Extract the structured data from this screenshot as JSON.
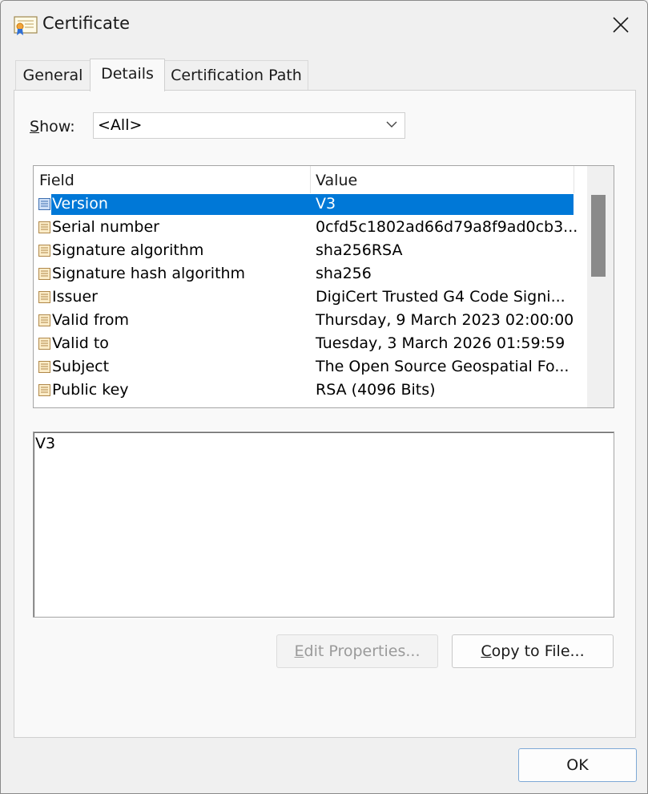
{
  "window": {
    "title": "Certificate",
    "icon": "certificate-icon",
    "close_icon": "close-icon"
  },
  "tabs": [
    {
      "label": "General",
      "active": false
    },
    {
      "label": "Details",
      "active": true
    },
    {
      "label": "Certification Path",
      "active": false
    }
  ],
  "show": {
    "label_prefix": "",
    "label_underlined": "S",
    "label_rest": "how:",
    "selected": "<All>"
  },
  "list": {
    "headers": {
      "field": "Field",
      "value": "Value"
    },
    "rows": [
      {
        "field": "Version",
        "value": "V3",
        "selected": true
      },
      {
        "field": "Serial number",
        "value": "0cfd5c1802ad66d79a8f9ad0cb3...",
        "selected": false
      },
      {
        "field": "Signature algorithm",
        "value": "sha256RSA",
        "selected": false
      },
      {
        "field": "Signature hash algorithm",
        "value": "sha256",
        "selected": false
      },
      {
        "field": "Issuer",
        "value": "DigiCert Trusted G4 Code Signi...",
        "selected": false
      },
      {
        "field": "Valid from",
        "value": "Thursday, 9 March 2023 02:00:00",
        "selected": false
      },
      {
        "field": "Valid to",
        "value": "Tuesday, 3 March 2026 01:59:59",
        "selected": false
      },
      {
        "field": "Subject",
        "value": "The Open Source Geospatial Fo...",
        "selected": false
      },
      {
        "field": "Public key",
        "value": "RSA (4096 Bits)",
        "selected": false
      }
    ]
  },
  "detail": {
    "text": "V3"
  },
  "buttons": {
    "edit_underlined": "E",
    "edit_rest": "dit Properties...",
    "copy_underlined": "C",
    "copy_rest": "opy to File...",
    "ok": "OK"
  },
  "colors": {
    "selection": "#0078d7",
    "background": "#f0f0f0"
  }
}
